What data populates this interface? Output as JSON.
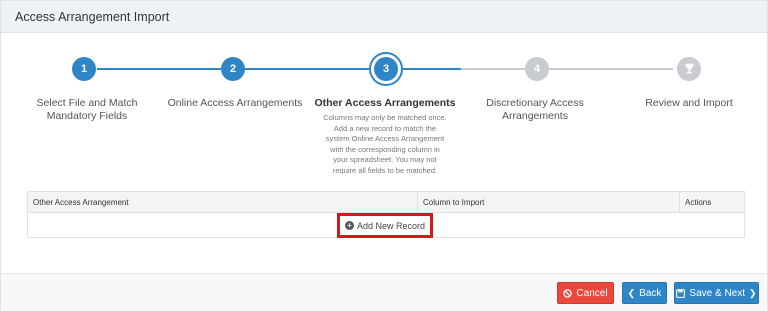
{
  "panel": {
    "title": "Access Arrangement Import"
  },
  "steps": [
    {
      "number": "1",
      "label_line1": "Select File and Match",
      "label_line2": "Mandatory Fields"
    },
    {
      "number": "2",
      "label_line1": "Online Access Arrangements",
      "label_line2": ""
    },
    {
      "number": "3",
      "label_line1": "Other Access Arrangements",
      "label_line2": "",
      "description": [
        "Columns may only be matched once.",
        "Add a new record to match the",
        "system Online Access Arrangement",
        "with the corresponding column in",
        "your spreadsheet. You may not",
        "require all fields to be matched."
      ]
    },
    {
      "number": "4",
      "label_line1": "Discretionary Access",
      "label_line2": "Arrangements"
    },
    {
      "number": "",
      "label_line1": "Review and Import",
      "label_line2": ""
    }
  ],
  "table": {
    "headers": [
      "Other Access Arrangement",
      "Column to Import",
      "Actions"
    ],
    "add_record_label": "Add New Record"
  },
  "footer": {
    "cancel_label": "Cancel",
    "back_label": "Back",
    "save_next_label": "Save & Next"
  },
  "colors": {
    "accent": "#2e86c7",
    "danger": "#e8493c",
    "highlight": "#d9161e"
  }
}
